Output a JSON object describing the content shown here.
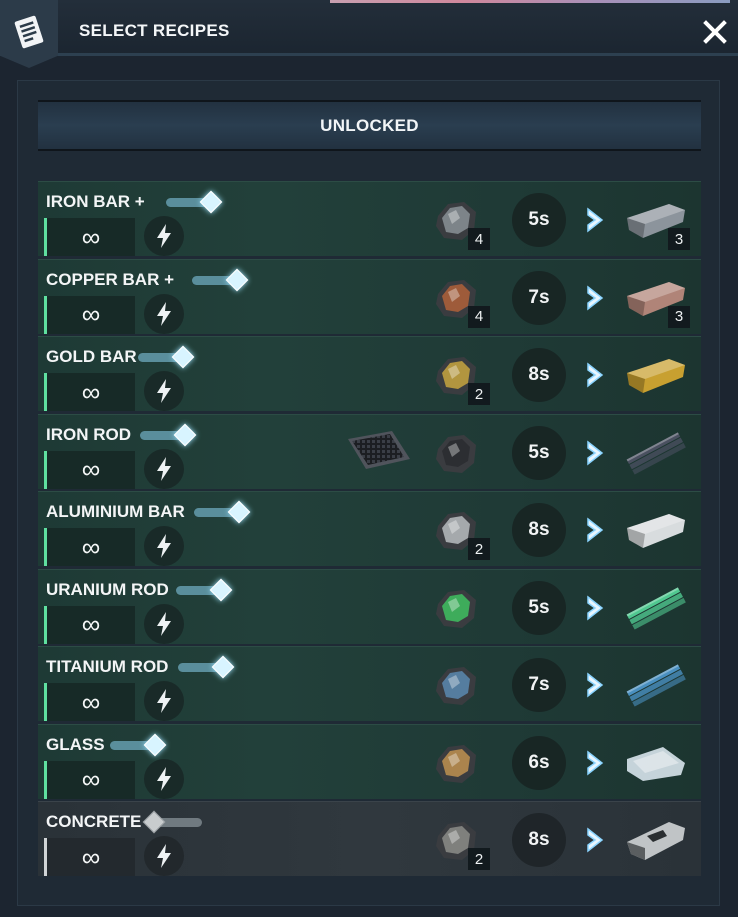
{
  "header": {
    "title": "SELECT RECIPES",
    "close_icon": "close-icon",
    "logo_icon": "recipe-list-icon"
  },
  "section": {
    "title": "UNLOCKED"
  },
  "colors": {
    "accent_cyan": "#d8f4ff",
    "row_green": "#22403a",
    "active_border": "#5fe0a0"
  },
  "recipes": [
    {
      "name": "IRON BAR +",
      "enabled": true,
      "repeat": "∞",
      "time": "5s",
      "input_icon": "iron-ore-icon",
      "input_color": "#8a9096",
      "input_qty": "4",
      "output_icon": "iron-bar-icon",
      "output_color": "#8c949c",
      "output_qty": "3",
      "extra_icon": ""
    },
    {
      "name": "COPPER BAR +",
      "enabled": true,
      "repeat": "∞",
      "time": "7s",
      "input_icon": "copper-ore-icon",
      "input_color": "#b0603a",
      "input_qty": "4",
      "output_icon": "copper-bar-icon",
      "output_color": "#b08478",
      "output_qty": "3",
      "extra_icon": ""
    },
    {
      "name": "GOLD BAR",
      "enabled": true,
      "repeat": "∞",
      "time": "8s",
      "input_icon": "gold-ore-icon",
      "input_color": "#c8a440",
      "input_qty": "2",
      "output_icon": "gold-bar-icon",
      "output_color": "#c8a030",
      "output_qty": "",
      "extra_icon": ""
    },
    {
      "name": "IRON ROD",
      "enabled": true,
      "repeat": "∞",
      "time": "5s",
      "input_icon": "coal-icon",
      "input_color": "#2a2c30",
      "input_qty": "",
      "output_icon": "iron-rod-icon",
      "output_color": "#4a5060",
      "output_qty": "",
      "extra_icon": "mesh-plate-icon"
    },
    {
      "name": "ALUMINIUM BAR",
      "enabled": true,
      "repeat": "∞",
      "time": "8s",
      "input_icon": "aluminium-ore-icon",
      "input_color": "#b8bcc0",
      "input_qty": "2",
      "output_icon": "aluminium-bar-icon",
      "output_color": "#d8dcde",
      "output_qty": "",
      "extra_icon": ""
    },
    {
      "name": "URANIUM ROD",
      "enabled": true,
      "repeat": "∞",
      "time": "5s",
      "input_icon": "uranium-ore-icon",
      "input_color": "#40c060",
      "input_qty": "",
      "output_icon": "uranium-rod-icon",
      "output_color": "#50c890",
      "output_qty": "",
      "extra_icon": ""
    },
    {
      "name": "TITANIUM ROD",
      "enabled": true,
      "repeat": "∞",
      "time": "7s",
      "input_icon": "titanium-ore-icon",
      "input_color": "#5a88b0",
      "input_qty": "",
      "output_icon": "titanium-rod-icon",
      "output_color": "#4a90c0",
      "output_qty": "",
      "extra_icon": ""
    },
    {
      "name": "GLASS",
      "enabled": true,
      "repeat": "∞",
      "time": "6s",
      "input_icon": "sand-icon",
      "input_color": "#c09050",
      "input_qty": "",
      "output_icon": "glass-pane-icon",
      "output_color": "#d8e4ec",
      "output_qty": "",
      "extra_icon": ""
    },
    {
      "name": "CONCRETE",
      "enabled": false,
      "repeat": "∞",
      "time": "8s",
      "input_icon": "stone-slab-icon",
      "input_color": "#8c8c88",
      "input_qty": "2",
      "output_icon": "concrete-block-icon",
      "output_color": "#c0c4c6",
      "output_qty": "",
      "extra_icon": ""
    }
  ]
}
